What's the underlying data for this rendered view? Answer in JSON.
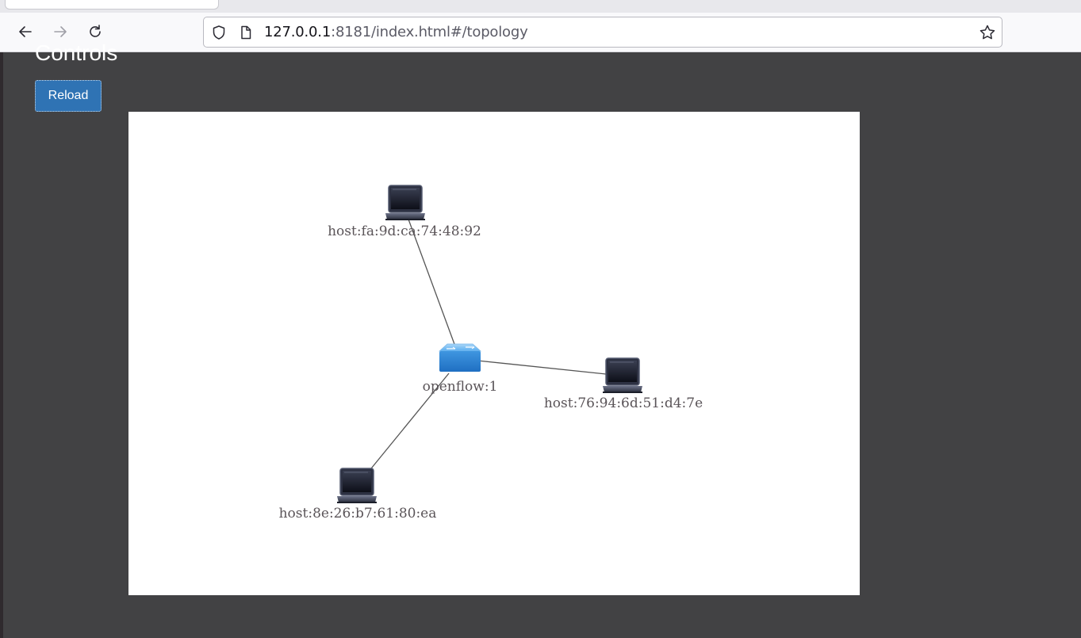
{
  "browser": {
    "url_host": "127.0.0.1",
    "url_rest": ":8181/index.html#/topology",
    "icons": {
      "back": "arrow-left-icon",
      "forward": "arrow-right-icon",
      "reload": "reload-icon",
      "shield": "shield-icon",
      "page": "page-icon",
      "bookmark": "star-icon"
    }
  },
  "page": {
    "heading": "Controls",
    "reload_label": "Reload"
  },
  "colors": {
    "page_background": "#424244",
    "button_blue": "#2f73b4",
    "canvas_background": "#ffffff",
    "link_line": "#555555",
    "switch_blue": "#4a9ee0"
  },
  "topology": {
    "nodes": [
      {
        "id": "host:fa:9d:ca:74:48:92",
        "label": "host:fa:9d:ca:74:48:92",
        "type": "host",
        "icon": "laptop-icon"
      },
      {
        "id": "openflow:1",
        "label": "openflow:1",
        "type": "switch",
        "icon": "switch-icon"
      },
      {
        "id": "host:76:94:6d:51:d4:7e",
        "label": "host:76:94:6d:51:d4:7e",
        "type": "host",
        "icon": "laptop-icon"
      },
      {
        "id": "host:8e:26:b7:61:80:ea",
        "label": "host:8e:26:b7:61:80:ea",
        "type": "host",
        "icon": "laptop-icon"
      }
    ],
    "links": [
      {
        "source": "host:fa:9d:ca:74:48:92",
        "target": "openflow:1"
      },
      {
        "source": "openflow:1",
        "target": "host:76:94:6d:51:d4:7e"
      },
      {
        "source": "openflow:1",
        "target": "host:8e:26:b7:61:80:ea"
      }
    ]
  }
}
